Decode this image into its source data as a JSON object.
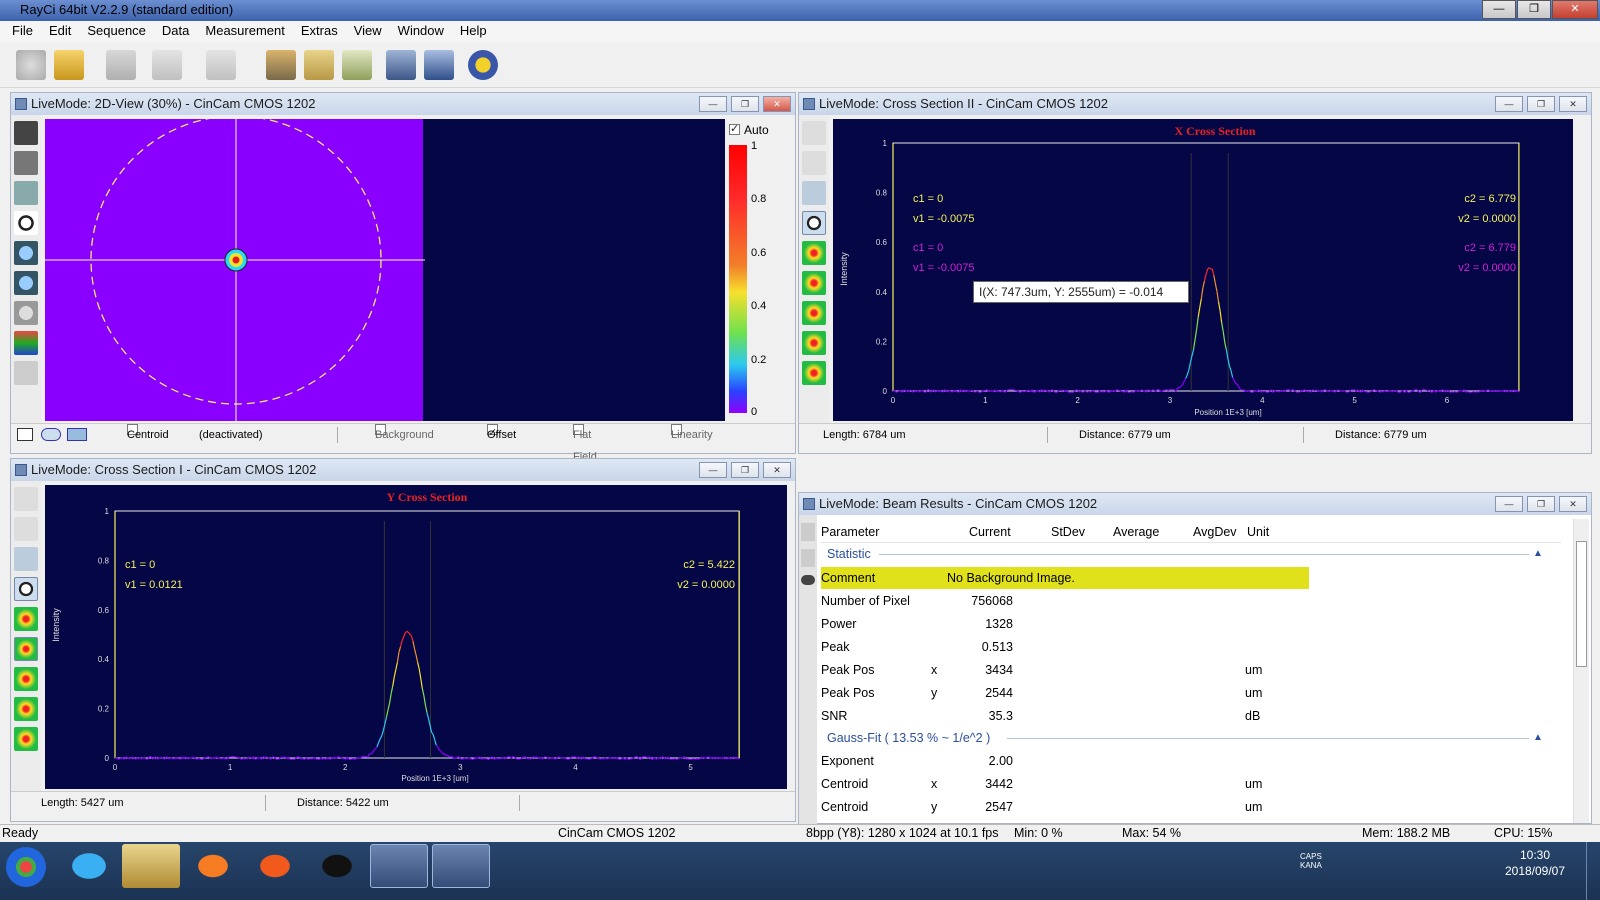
{
  "app": {
    "title": "RayCi 64bit V2.2.9 (standard edition)"
  },
  "menu": [
    "File",
    "Edit",
    "Sequence",
    "Data",
    "Measurement",
    "Extras",
    "View",
    "Window",
    "Help"
  ],
  "view2d": {
    "title": "LiveMode: 2D-View (30%) - CinCam CMOS 1202",
    "auto_label": "Auto",
    "colorbar_ticks": [
      "1",
      "0.8",
      "0.6",
      "0.4",
      "0.2",
      "0"
    ],
    "footer": {
      "centroid": "Centroid",
      "deactivated": "(deactivated)",
      "background": "Background",
      "offset": "Offset",
      "flat_field": "Flat Field",
      "linearity": "Linearity"
    }
  },
  "cross2": {
    "title": "LiveMode: Cross Section II - CinCam CMOS 1202",
    "chart_title": "X Cross Section",
    "ylabel": "Intensity",
    "xlabel": "Position 1E+3 [um]",
    "yticks": [
      "1",
      "0.8",
      "0.6",
      "0.4",
      "0.2",
      "0"
    ],
    "xticks": [
      "0",
      "1",
      "2",
      "3",
      "4",
      "5",
      "6"
    ],
    "c1_yellow": "c1 = 0",
    "v1_yellow": "v1 = -0.0075",
    "c1_mag": "c1 = 0",
    "v1_mag": "v1 = -0.0075",
    "c2_yellow": "c2 = 6.779",
    "v2_yellow": "v2 = 0.0000",
    "c2_mag": "c2 = 6.779",
    "v2_mag": "v2 = 0.0000",
    "tooltip": "I(X: 747.3um, Y: 2555um) = -0.014",
    "footer": {
      "length": "Length:  6784 um",
      "distance1": "Distance: 6779 um",
      "distance2": "Distance: 6779 um"
    }
  },
  "cross1": {
    "title": "LiveMode: Cross Section I - CinCam CMOS 1202",
    "chart_title": "Y Cross Section",
    "ylabel": "Intensity",
    "xlabel": "Position 1E+3 [um]",
    "yticks": [
      "1",
      "0.8",
      "0.6",
      "0.4",
      "0.2",
      "0"
    ],
    "xticks": [
      "0",
      "1",
      "2",
      "3",
      "4",
      "5"
    ],
    "c1": "c1 = 0",
    "v1": "v1 = 0.0121",
    "c2": "c2 = 5.422",
    "v2": "v2 = 0.0000",
    "footer": {
      "length": "Length:  5427 um",
      "distance": "Distance: 5422 um"
    }
  },
  "chart_data": [
    {
      "type": "line",
      "title": "X Cross Section",
      "xlabel": "Position 1E+3 [um]",
      "ylabel": "Intensity",
      "xlim": [
        0,
        6.78
      ],
      "ylim": [
        0,
        1
      ],
      "peak_x": 3.43,
      "peak_y": 0.5,
      "sigma": 0.12
    },
    {
      "type": "line",
      "title": "Y Cross Section",
      "xlabel": "Position 1E+3 [um]",
      "ylabel": "Intensity",
      "xlim": [
        0,
        5.42
      ],
      "ylim": [
        0,
        1
      ],
      "peak_x": 2.54,
      "peak_y": 0.51,
      "sigma": 0.12
    }
  ],
  "results": {
    "title": "LiveMode: Beam Results - CinCam CMOS 1202",
    "headers": [
      "Parameter",
      "Current",
      "StDev",
      "Average",
      "AvgDev",
      "Unit"
    ],
    "section1": "Statistic",
    "comment_label": "Comment",
    "comment_value": "No Background Image.",
    "rows1": [
      {
        "p": "Number of Pixel",
        "a": "",
        "v": "756068",
        "u": ""
      },
      {
        "p": "Power",
        "a": "",
        "v": "1328",
        "u": ""
      },
      {
        "p": "Peak",
        "a": "",
        "v": "0.513",
        "u": ""
      },
      {
        "p": "Peak Pos",
        "a": "x",
        "v": "3434",
        "u": "um"
      },
      {
        "p": "Peak Pos",
        "a": "y",
        "v": "2544",
        "u": "um"
      },
      {
        "p": "SNR",
        "a": "",
        "v": "35.3",
        "u": "dB"
      }
    ],
    "section2": "Gauss-Fit ( 13.53 % ~ 1/e^2 )",
    "rows2": [
      {
        "p": "Exponent",
        "a": "",
        "v": "2.00",
        "u": ""
      },
      {
        "p": "Centroid",
        "a": "x",
        "v": "3442",
        "u": "um"
      },
      {
        "p": "Centroid",
        "a": "y",
        "v": "2547",
        "u": "um"
      }
    ]
  },
  "status": {
    "ready": "Ready",
    "camera": "CinCam CMOS 1202",
    "format": "8bpp (Y8): 1280 x 1024 at 10.1 fps",
    "min": "Min:   0 %",
    "max": "Max:   54 %",
    "mem": "Mem: 188.2 MB",
    "cpu": "CPU: 15%"
  },
  "taskbar": {
    "time": "10:30",
    "date": "2018/09/07",
    "caps": "CAPS",
    "kana": "KANA"
  }
}
